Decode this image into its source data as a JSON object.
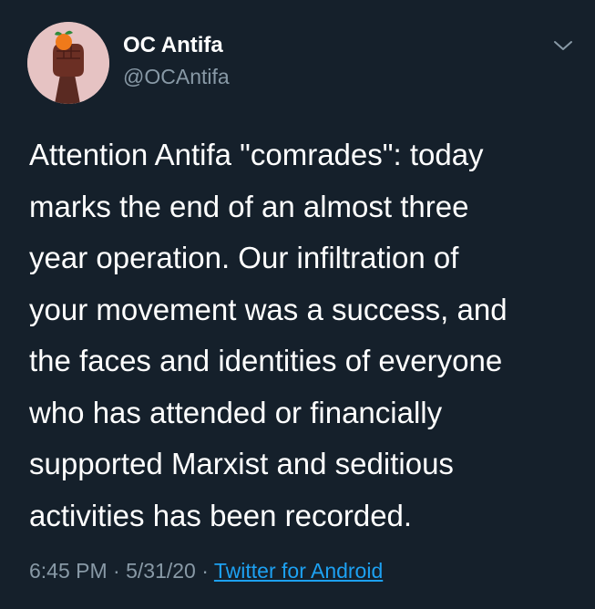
{
  "user": {
    "display_name": "OC Antifa",
    "handle": "@OCAntifa",
    "avatar": "raised-fist-with-orange-avatar"
  },
  "tweet": {
    "lines": [
      "Attention Antifa \"comrades\": today",
      "marks the end of an almost three",
      "year operation. Our infiltration of",
      "your movement was a success, and",
      "the faces and identities of everyone",
      "who has attended or financially",
      "supported Marxist and seditious",
      "activities has been recorded."
    ]
  },
  "meta": {
    "time": "6:45 PM",
    "separator1": " · ",
    "date": "5/31/20",
    "separator2": " · ",
    "source": "Twitter for Android"
  },
  "icons": {
    "caret": "chevron-down-icon"
  },
  "colors": {
    "background": "#15202b",
    "text": "#ffffff",
    "secondary": "#8899a6",
    "link": "#1da1f2"
  }
}
